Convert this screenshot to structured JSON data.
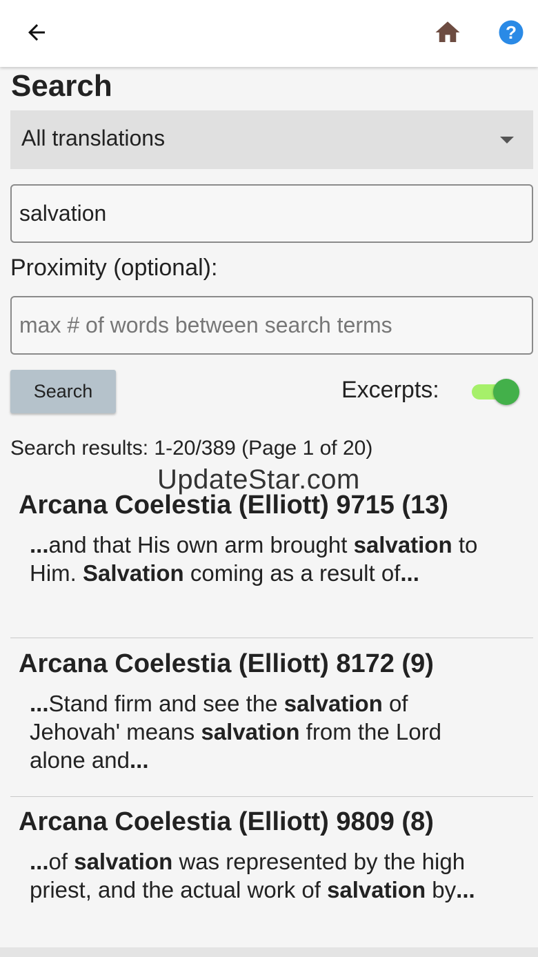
{
  "appbar": {
    "back_icon": "arrow-left-icon",
    "home_icon": "home-icon",
    "home_color": "#6d4c41",
    "help_icon": "help-circle-icon",
    "help_color": "#2a8ae6"
  },
  "page": {
    "title": "Search"
  },
  "form": {
    "translation_select": "All translations",
    "search_value": "salvation",
    "proximity_label": "Proximity (optional):",
    "proximity_placeholder": "max # of words between search terms",
    "search_button": "Search",
    "excerpts_label": "Excerpts:",
    "excerpts_on": true,
    "toggle_color": "#43b04a"
  },
  "results": {
    "summary": "Search results: 1-20/389 (Page 1 of 20)",
    "items": [
      {
        "title": "Arcana Coelestia (Elliott) 9715 (13)",
        "excerpt": [
          {
            "t": "...",
            "b": true
          },
          {
            "t": "and that His own arm brought ",
            "b": false
          },
          {
            "t": "salvation",
            "b": true
          },
          {
            "t": " to Him. ",
            "b": false
          },
          {
            "t": "Salvation",
            "b": true
          },
          {
            "t": " coming as a result of",
            "b": false
          },
          {
            "t": "...",
            "b": true
          }
        ]
      },
      {
        "title": "Arcana Coelestia (Elliott) 8172 (9)",
        "excerpt": [
          {
            "t": "...",
            "b": true
          },
          {
            "t": "Stand firm and see the ",
            "b": false
          },
          {
            "t": "salvation",
            "b": true
          },
          {
            "t": " of Jehovah' means ",
            "b": false
          },
          {
            "t": "salvation",
            "b": true
          },
          {
            "t": " from the Lord alone and",
            "b": false
          },
          {
            "t": "...",
            "b": true
          }
        ]
      },
      {
        "title": "Arcana Coelestia (Elliott) 9809 (8)",
        "excerpt": [
          {
            "t": "...",
            "b": true
          },
          {
            "t": "of ",
            "b": false
          },
          {
            "t": "salvation",
            "b": true
          },
          {
            "t": " was represented by the high priest, and the actual work of ",
            "b": false
          },
          {
            "t": "salvation",
            "b": true
          },
          {
            "t": " by",
            "b": false
          },
          {
            "t": "...",
            "b": true
          }
        ]
      }
    ]
  },
  "watermark": "UpdateStar.com"
}
